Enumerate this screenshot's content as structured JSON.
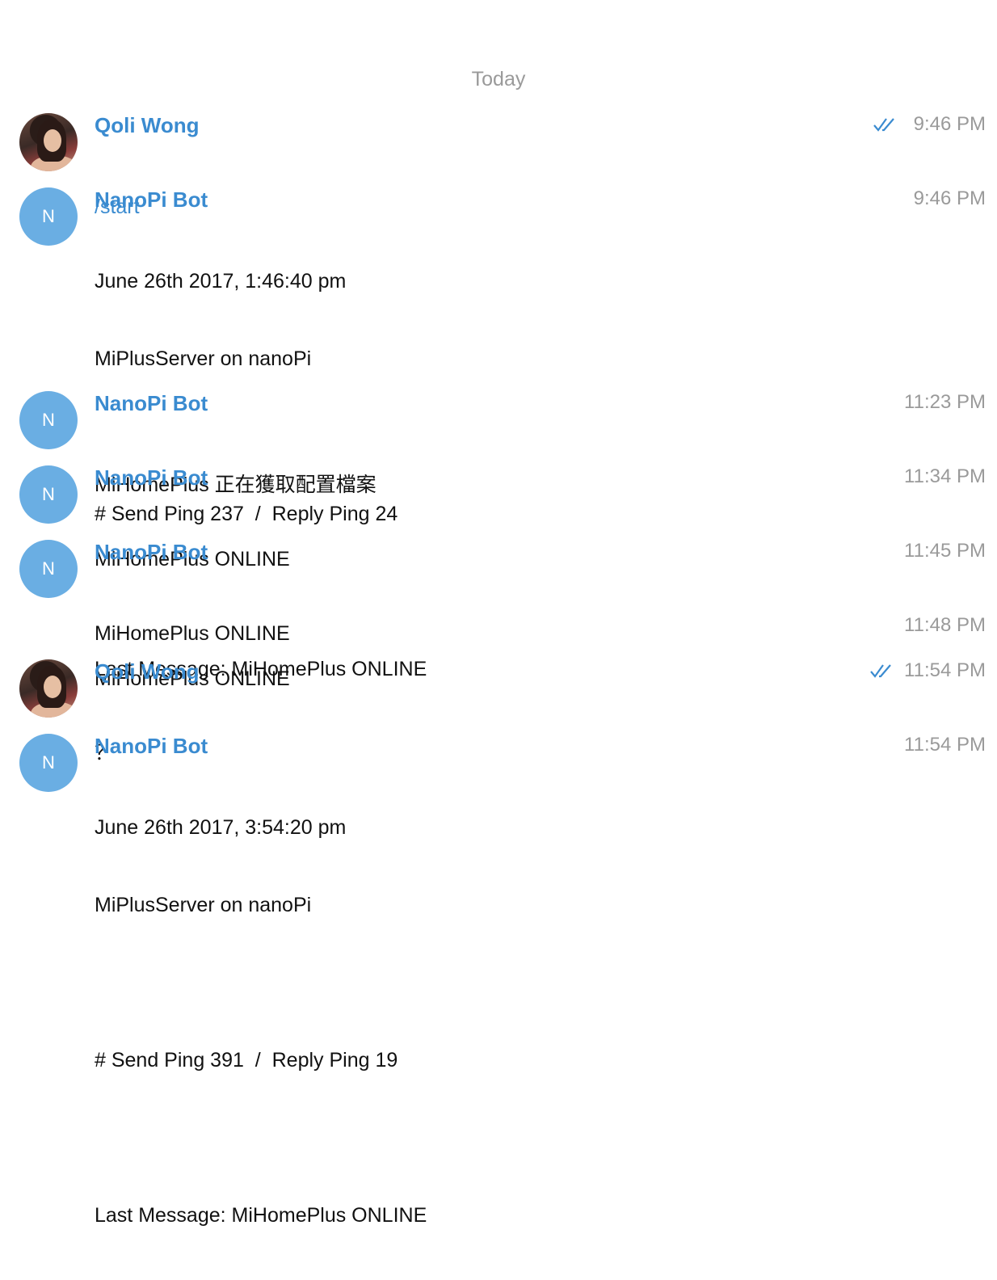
{
  "date_separator": "Today",
  "messages": [
    {
      "sender": "Qoli Wong",
      "avatar": "photo",
      "time": "9:46 PM",
      "read": true,
      "lines": [
        "/start"
      ]
    },
    {
      "sender": "NanoPi Bot",
      "avatar": "N",
      "time": "9:46 PM",
      "lines": [
        "June 26th 2017, 1:46:40 pm",
        "MiPlusServer on nanoPi",
        "",
        "# Send Ping 237  /  Reply Ping 24",
        "",
        "Last Message: MiHomePlus ONLINE"
      ]
    },
    {
      "sender": "NanoPi Bot",
      "avatar": "N",
      "time": "11:23 PM",
      "lines": [
        "MiHomePlus 正在獲取配置檔案"
      ]
    },
    {
      "sender": "NanoPi Bot",
      "avatar": "N",
      "time": "11:34 PM",
      "lines": [
        "MiHomePlus ONLINE"
      ]
    },
    {
      "sender": "NanoPi Bot",
      "avatar": "N",
      "time": "11:45 PM",
      "lines": [
        "MiHomePlus ONLINE"
      ]
    },
    {
      "time": "11:48 PM",
      "lines": [
        "MiHomePlus ONLINE"
      ]
    },
    {
      "sender": "Qoli Wong",
      "avatar": "photo",
      "time": "11:54 PM",
      "read": true,
      "lines": [
        "？"
      ]
    },
    {
      "sender": "NanoPi Bot",
      "avatar": "N",
      "time": "11:54 PM",
      "lines": [
        "June 26th 2017, 3:54:20 pm",
        "MiPlusServer on nanoPi",
        "",
        "# Send Ping 391  /  Reply Ping 19",
        "",
        "Last Message: MiHomePlus ONLINE"
      ]
    }
  ],
  "colors": {
    "sender": "#3a8bd0",
    "avatar_bg": "#6aaee3",
    "time": "#9a9a9a",
    "check": "#3a8bd0"
  }
}
